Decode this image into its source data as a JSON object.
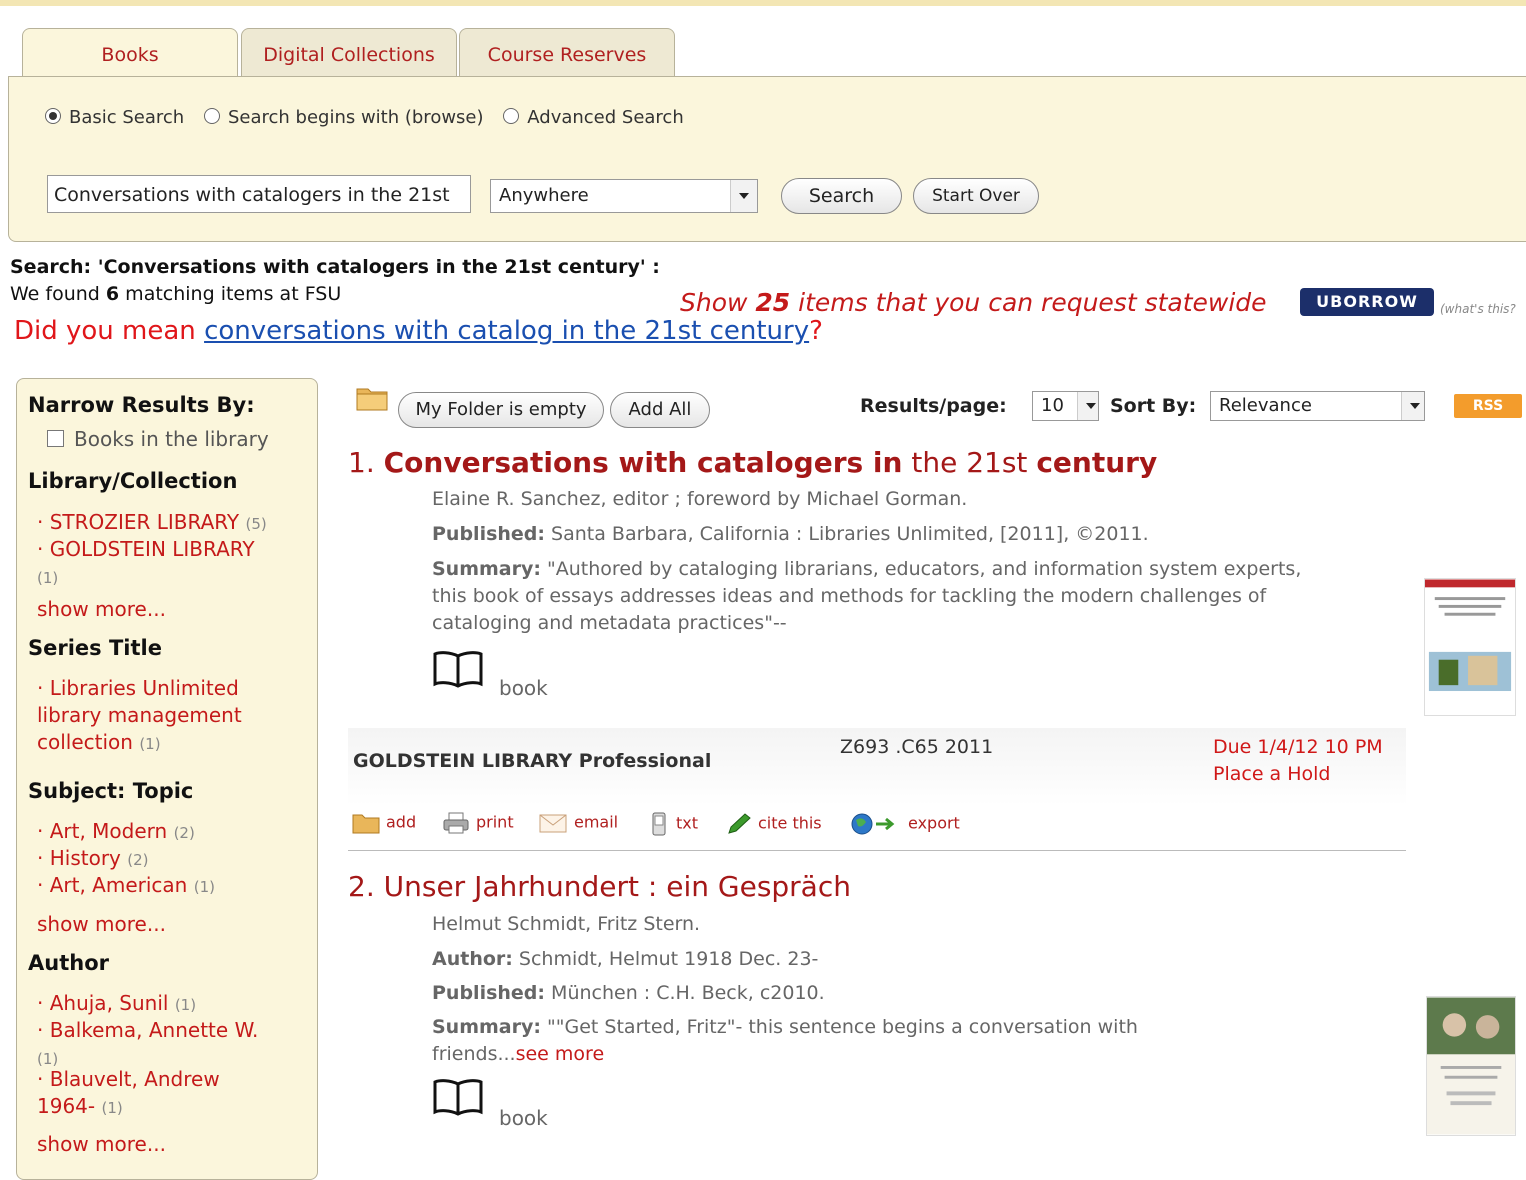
{
  "tabs": [
    {
      "label": "Books"
    },
    {
      "label": "Digital Collections"
    },
    {
      "label": "Course Reserves"
    }
  ],
  "search_modes": [
    {
      "label": "Basic Search",
      "selected": true
    },
    {
      "label": "Search begins with (browse)",
      "selected": false
    },
    {
      "label": "Advanced Search",
      "selected": false
    }
  ],
  "query": {
    "value": "Conversations with catalogers in the 21st"
  },
  "scope": {
    "selected": "Anywhere"
  },
  "buttons": {
    "search": "Search",
    "start_over": "Start Over"
  },
  "summary": {
    "search_line": "Search: 'Conversations with catalogers in the 21st century' :",
    "found_prefix": "We found ",
    "found_count": "6",
    "found_suffix": " matching items at FSU"
  },
  "statewide": {
    "prefix": "Show ",
    "count": "25",
    "suffix": " items that you can request statewide",
    "uborrow": "UBORROW",
    "whats_this": "(what's this?"
  },
  "did_you_mean": {
    "prefix": "Did you mean ",
    "suggestion": "conversations with catalog in the 21st century",
    "suffix": "?"
  },
  "sidebar": {
    "title": "Narrow Results By:",
    "books_in_library": "Books in the library",
    "library_heading": "Library/Collection",
    "library_items": [
      {
        "label": "STROZIER LIBRARY",
        "count": "(5)"
      },
      {
        "label": "GOLDSTEIN LIBRARY",
        "count": "(1)"
      }
    ],
    "series_heading": "Series Title",
    "series_items": [
      {
        "label": "Libraries Unlimited library management collection",
        "count": "(1)"
      }
    ],
    "subject_heading": "Subject: Topic",
    "subject_items": [
      {
        "label": "Art, Modern",
        "count": "(2)"
      },
      {
        "label": "History",
        "count": "(2)"
      },
      {
        "label": "Art, American",
        "count": "(1)"
      }
    ],
    "author_heading": "Author",
    "author_items": [
      {
        "label": "Ahuja, Sunil",
        "count": "(1)"
      },
      {
        "label": "Balkema, Annette W.",
        "count": "(1)"
      },
      {
        "label": "Blauvelt, Andrew 1964-",
        "count": "(1)"
      }
    ],
    "show_more": "show more..."
  },
  "toolbar": {
    "folder": "My Folder is empty",
    "add_all": "Add All",
    "results_per_page_label": "Results/page:",
    "results_per_page": "10",
    "sort_label": "Sort By:",
    "sort_value": "Relevance",
    "rss": "RSS"
  },
  "results": [
    {
      "number": "1. ",
      "title_parts": [
        "Conversations with catalogers in",
        "the 21st",
        "century"
      ],
      "responsibility": "Elaine R. Sanchez, editor ; foreword by Michael Gorman.",
      "published_label": "Published:",
      "published": "Santa Barbara, California : Libraries Unlimited, [2011], ©2011.",
      "summary_label": "Summary:",
      "summary": "\"Authored by cataloging librarians, educators, and information system experts, this book of essays addresses ideas and methods for tackling the modern challenges of cataloging and metadata practices\"--",
      "format": "book",
      "holding": {
        "location": "GOLDSTEIN LIBRARY Professional",
        "call_number": "Z693 .C65 2011",
        "due": "Due 1/4/12 10 PM",
        "hold": "Place a Hold"
      }
    },
    {
      "number": "2. ",
      "title": "Unser Jahrhundert : ein Gespräch",
      "responsibility": "Helmut Schmidt, Fritz Stern.",
      "author_label": "Author:",
      "author": "Schmidt, Helmut 1918 Dec. 23-",
      "published_label": "Published:",
      "published": "München : C.H. Beck, c2010.",
      "summary_label": "Summary:",
      "summary": "\"\"Get Started, Fritz\"- this sentence begins a conversation with friends...",
      "see_more": "see more",
      "format": "book"
    }
  ],
  "actions": [
    {
      "label": "add"
    },
    {
      "label": "print"
    },
    {
      "label": "email"
    },
    {
      "label": "txt"
    },
    {
      "label": "cite this"
    },
    {
      "label": "export"
    }
  ],
  "colors": {
    "accent_red": "#c41a1a",
    "title_red": "#a41818",
    "panel_bg": "#fbf6dc",
    "link_blue": "#1a4fb0"
  }
}
